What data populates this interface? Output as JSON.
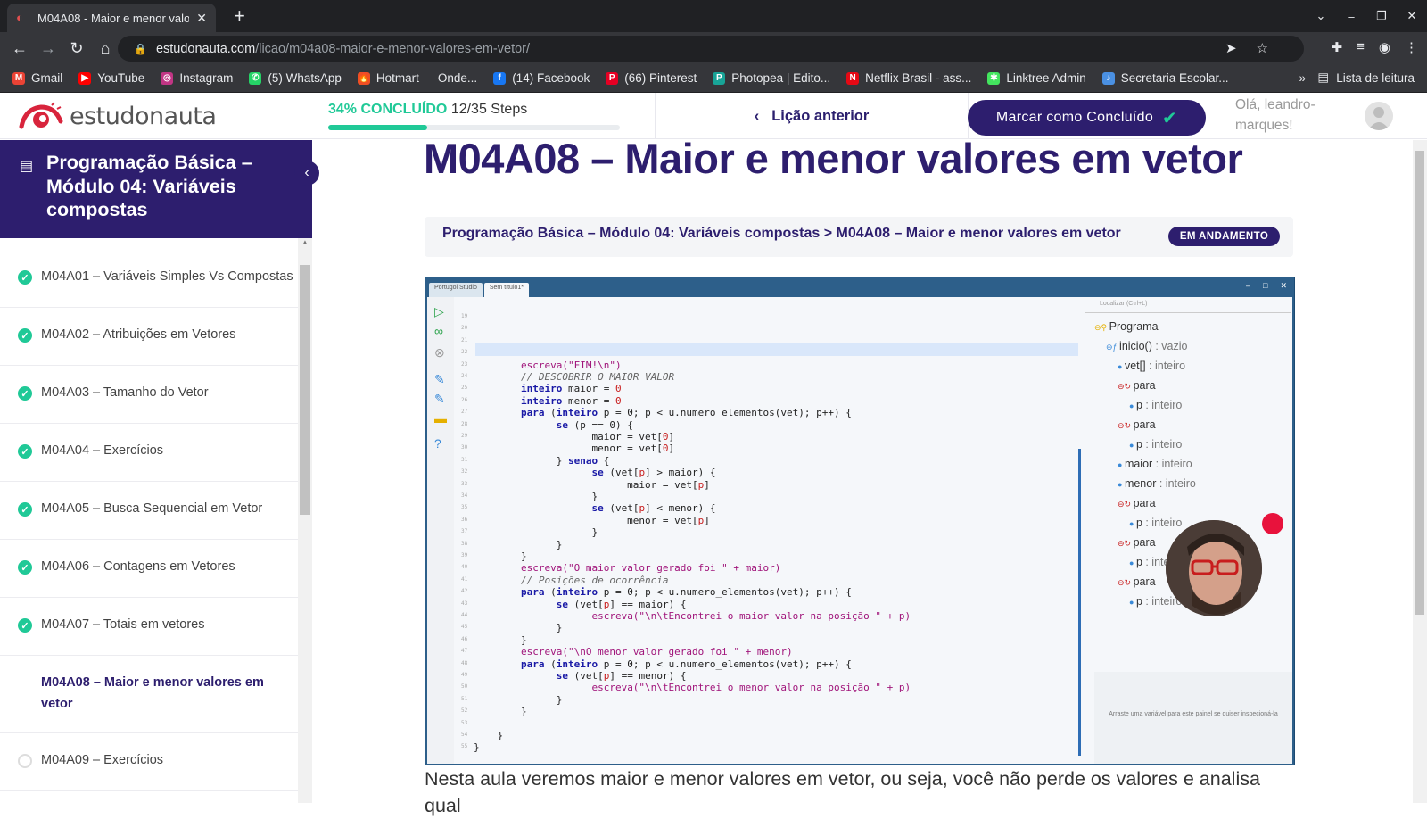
{
  "browser": {
    "tab_title": "M04A08 - Maior e menor valo",
    "url_domain": "estudonauta.com",
    "url_path": "/licao/m04a08-maior-e-menor-valores-em-vetor/",
    "bookmarks": [
      {
        "label": "Gmail",
        "color": "#ea4335",
        "icon": "M"
      },
      {
        "label": "YouTube",
        "color": "#ff0000",
        "icon": "▶"
      },
      {
        "label": "Instagram",
        "color": "#c13584",
        "icon": "◎"
      },
      {
        "label": "(5) WhatsApp",
        "color": "#25d366",
        "icon": "✆"
      },
      {
        "label": "Hotmart — Onde...",
        "color": "#f04e23",
        "icon": "🔥"
      },
      {
        "label": "(14) Facebook",
        "color": "#1877f2",
        "icon": "f"
      },
      {
        "label": "(66) Pinterest",
        "color": "#e60023",
        "icon": "P"
      },
      {
        "label": "Photopea | Edito...",
        "color": "#18a497",
        "icon": "P"
      },
      {
        "label": "Netflix Brasil - ass...",
        "color": "#e50914",
        "icon": "N"
      },
      {
        "label": "Linktree Admin",
        "color": "#43e55e",
        "icon": "✱"
      },
      {
        "label": "Secretaria Escolar...",
        "color": "#4a90e2",
        "icon": "♪"
      }
    ],
    "reading_list": "Lista de leitura"
  },
  "header": {
    "logo_text": "estudonauta",
    "progress_pct_label": "34% CONCLUÍDO",
    "progress_steps": "12/35 Steps",
    "progress_fraction": 0.34,
    "prev_lesson": "Lição anterior",
    "mark_complete": "Marcar como Concluído",
    "greeting": "Olá, leandro-marques!"
  },
  "sidebar": {
    "course_title": "Programação Básica – Módulo 04: Variáveis compostas",
    "lessons": [
      {
        "label": "M04A01 – Variáveis Simples Vs Compostas",
        "status": "done"
      },
      {
        "label": "M04A02 – Atribuições em Vetores",
        "status": "done"
      },
      {
        "label": "M04A03 – Tamanho do Vetor",
        "status": "done"
      },
      {
        "label": "M04A04 – Exercícios",
        "status": "done"
      },
      {
        "label": "M04A05 – Busca Sequencial em Vetor",
        "status": "done"
      },
      {
        "label": "M04A06 – Contagens em Vetores",
        "status": "done"
      },
      {
        "label": "M04A07 – Totais em vetores",
        "status": "done"
      },
      {
        "label": "M04A08 – Maior e menor valores em vetor",
        "status": "current"
      },
      {
        "label": "M04A09 – Exercícios",
        "status": "todo"
      }
    ]
  },
  "main": {
    "title": "M04A08 – Maior e menor valores em vetor",
    "breadcrumb": "Programação Básica – Módulo 04: Variáveis compostas > M04A08 – Maior e menor valores em vetor",
    "badge": "EM ANDAMENTO",
    "description": "Nesta aula veremos maior e menor valores em vetor, ou seja, você não perde os valores e analisa qual"
  },
  "video": {
    "tabs": [
      "Portugol Studio",
      "Sem título1*"
    ],
    "search_placeholder": "Localizar (Ctrl+L)",
    "inspect_hint": "Arraste uma variável para este painel se quiser inspecioná-la",
    "line_numbers": [
      "19",
      "20",
      "21",
      "22",
      "23",
      "24",
      "25",
      "26",
      "27",
      "28",
      "29",
      "30",
      "31",
      "32",
      "33",
      "34",
      "35",
      "36",
      "37",
      "38",
      "39",
      "40",
      "41",
      "42",
      "43",
      "44",
      "45",
      "46",
      "47",
      "48",
      "49",
      "50",
      "51",
      "52",
      "53",
      "54",
      "55"
    ],
    "code_lines": [
      "",
      "",
      "",
      "",
      "        escreva(\"FIM!\\n\")",
      "        // DESCOBRIR O MAIOR VALOR",
      "        inteiro maior = 0",
      "        inteiro menor = 0",
      "        para (inteiro p = 0; p < u.numero_elementos(vet); p++) {",
      "              se (p == 0) {",
      "                    maior = vet[0]",
      "                    menor = vet[0]",
      "              } senao {",
      "                    se (vet[p] > maior) {",
      "                          maior = vet[p]",
      "                    }",
      "                    se (vet[p] < menor) {",
      "                          menor = vet[p]",
      "                    }",
      "              }",
      "        }",
      "        escreva(\"O maior valor gerado foi \" + maior)",
      "        // Posições de ocorrência",
      "        para (inteiro p = 0; p < u.numero_elementos(vet); p++) {",
      "              se (vet[p] == maior) {",
      "                    escreva(\"\\n\\tEncontrei o maior valor na posição \" + p)",
      "              }",
      "        }",
      "        escreva(\"\\nO menor valor gerado foi \" + menor)",
      "        para (inteiro p = 0; p < u.numero_elementos(vet); p++) {",
      "              se (vet[p] == menor) {",
      "                    escreva(\"\\n\\tEncontrei o menor valor na posição \" + p)",
      "              }",
      "        }",
      "",
      "    }",
      "}"
    ],
    "tree": [
      {
        "label": "Programa",
        "type": "",
        "indent": 0
      },
      {
        "label": "inicio()",
        "type": " : vazio",
        "indent": 1
      },
      {
        "label": "vet[]",
        "type": " : inteiro",
        "indent": 2
      },
      {
        "label": "para",
        "type": "",
        "indent": 2
      },
      {
        "label": "p",
        "type": " : inteiro",
        "indent": 3
      },
      {
        "label": "para",
        "type": "",
        "indent": 2
      },
      {
        "label": "p",
        "type": " : inteiro",
        "indent": 3
      },
      {
        "label": "maior",
        "type": " : inteiro",
        "indent": 2
      },
      {
        "label": "menor",
        "type": " : inteiro",
        "indent": 2
      },
      {
        "label": "para",
        "type": "",
        "indent": 2
      },
      {
        "label": "p",
        "type": " : inteiro",
        "indent": 3
      },
      {
        "label": "para",
        "type": "",
        "indent": 2
      },
      {
        "label": "p",
        "type": " : inteiro",
        "indent": 3
      },
      {
        "label": "para",
        "type": "",
        "indent": 2
      },
      {
        "label": "p",
        "type": " : inteiro",
        "indent": 3
      }
    ]
  },
  "colors": {
    "brand": "#2d1e6e",
    "accent": "#20c997",
    "record": "#e8123c"
  }
}
